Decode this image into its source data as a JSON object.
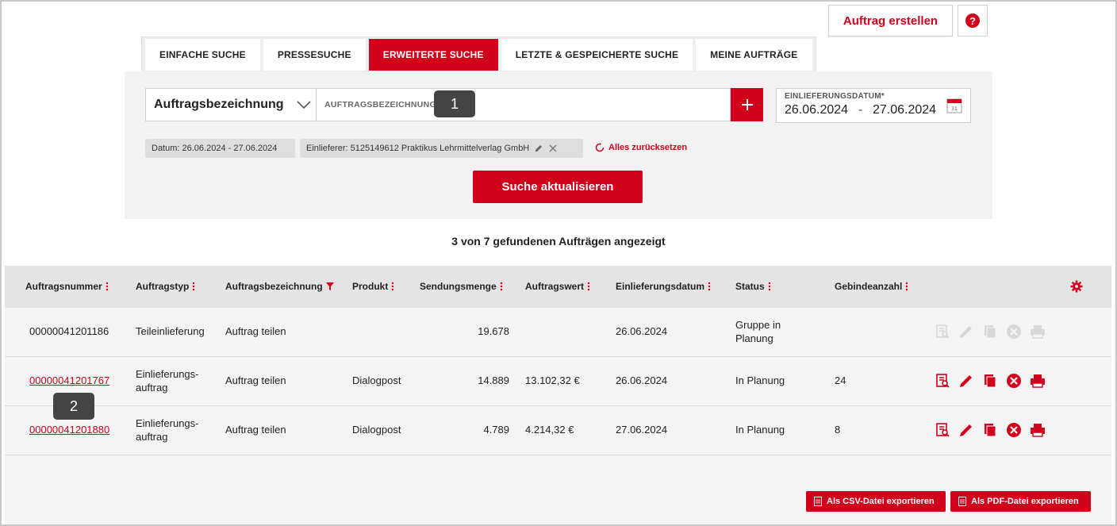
{
  "header": {
    "create_label": "Auftrag erstellen",
    "help_label": "?"
  },
  "tabs": [
    {
      "label": "EINFACHE SUCHE",
      "active": false
    },
    {
      "label": "PRESSESUCHE",
      "active": false
    },
    {
      "label": "ERWEITERTE SUCHE",
      "active": true
    },
    {
      "label": "LETZTE & GESPEICHERTE SUCHE",
      "active": false
    },
    {
      "label": "MEINE AUFTRÄGE",
      "active": false
    }
  ],
  "search": {
    "field_select": "Auftragsbezeichnung",
    "input_placeholder": "AUFTRAGSBEZEICHNUNG",
    "add_label": "+",
    "date_label": "EINLIEFERUNGSDATUM*",
    "date_from": "26.06.2024",
    "date_sep": "-",
    "date_to": "27.06.2024",
    "chips": [
      "Datum: 26.06.2024 - 27.06.2024",
      "Einlieferer: 5125149612 Praktikus Lehrmittelverlag GmbH"
    ],
    "reset_label": "Alles zurücksetzen",
    "update_label": "Suche aktualisieren"
  },
  "results": {
    "count_text": "3 von 7 gefundenen Aufträgen angezeigt"
  },
  "table": {
    "headers": [
      "Auftragsnummer",
      "Auftragstyp",
      "Auftragsbezeichnung",
      "Produkt",
      "Sendungsmenge",
      "Auftragswert",
      "Einlieferungsdatum",
      "Status",
      "Gebindeanzahl"
    ],
    "rows": [
      {
        "nummer": "00000041201186",
        "typ": "Teileinlieferung",
        "typ2": "",
        "bezeichnung": "Auftrag teilen",
        "produkt": "",
        "menge": "19.678",
        "wert": "",
        "datum": "26.06.2024",
        "status": "Gruppe in",
        "status2": "Planung",
        "gebinde": "",
        "link": false,
        "actions_enabled": false
      },
      {
        "nummer": "00000041201767",
        "typ": "Einlieferungs-",
        "typ2": "auftrag",
        "bezeichnung": "Auftrag teilen",
        "produkt": "Dialogpost",
        "menge": "14.889",
        "wert": "13.102,32 €",
        "datum": "26.06.2024",
        "status": "In Planung",
        "status2": "",
        "gebinde": "24",
        "link": true,
        "actions_enabled": true
      },
      {
        "nummer": "00000041201880",
        "typ": "Einlieferungs-",
        "typ2": "auftrag",
        "bezeichnung": "Auftrag teilen",
        "produkt": "Dialogpost",
        "menge": "4.789",
        "wert": "4.214,32 €",
        "datum": "27.06.2024",
        "status": "In Planung",
        "status2": "",
        "gebinde": "8",
        "link": true,
        "actions_enabled": true
      }
    ]
  },
  "markers": [
    "1",
    "2"
  ],
  "export": {
    "csv_label": "Als CSV-Datei exportieren",
    "pdf_label": "Als PDF-Datei exportieren"
  },
  "colors": {
    "brand_red": "#d1001b",
    "panel_bg": "#f2f2f2"
  },
  "icons": [
    "help-icon",
    "chevron-down-icon",
    "plus-icon",
    "calendar-icon",
    "pencil-icon",
    "close-icon",
    "reset-icon",
    "menu-dots-icon",
    "filter-icon",
    "gear-icon",
    "details-icon",
    "edit-icon",
    "copy-icon",
    "cancel-icon",
    "print-icon",
    "file-icon"
  ]
}
